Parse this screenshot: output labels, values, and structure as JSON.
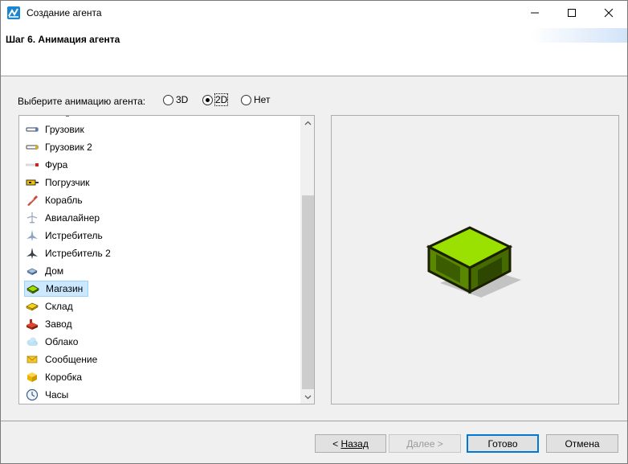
{
  "window": {
    "title": "Создание агента",
    "step_title": "Шаг 6. Анимация агента"
  },
  "animation_choice": {
    "label": "Выберите анимацию агента:",
    "options": [
      "3D",
      "2D",
      "Нет"
    ],
    "selected": "2D"
  },
  "agent_list": {
    "items": [
      {
        "label": "Грузовик",
        "icon": "truck-icon"
      },
      {
        "label": "Грузовик 2",
        "icon": "truck2-icon"
      },
      {
        "label": "Фура",
        "icon": "trailer-truck-icon"
      },
      {
        "label": "Погрузчик",
        "icon": "forklift-icon"
      },
      {
        "label": "Корабль",
        "icon": "ship-icon"
      },
      {
        "label": "Авиалайнер",
        "icon": "airliner-icon"
      },
      {
        "label": "Истребитель",
        "icon": "fighter-jet-icon"
      },
      {
        "label": "Истребитель 2",
        "icon": "fighter-jet2-icon"
      },
      {
        "label": "Дом",
        "icon": "house-icon"
      },
      {
        "label": "Магазин",
        "icon": "store-icon"
      },
      {
        "label": "Склад",
        "icon": "warehouse-icon"
      },
      {
        "label": "Завод",
        "icon": "factory-icon"
      },
      {
        "label": "Облако",
        "icon": "cloud-icon"
      },
      {
        "label": "Сообщение",
        "icon": "message-icon"
      },
      {
        "label": "Коробка",
        "icon": "box-icon"
      },
      {
        "label": "Часы",
        "icon": "clock-icon"
      }
    ],
    "selected": "Магазин"
  },
  "preview": {
    "icon": "store-preview-icon"
  },
  "buttons": {
    "back_prefix": "< ",
    "back_label": "Назад",
    "next_label": "Далее >",
    "done_label": "Готово",
    "cancel_label": "Отмена"
  }
}
